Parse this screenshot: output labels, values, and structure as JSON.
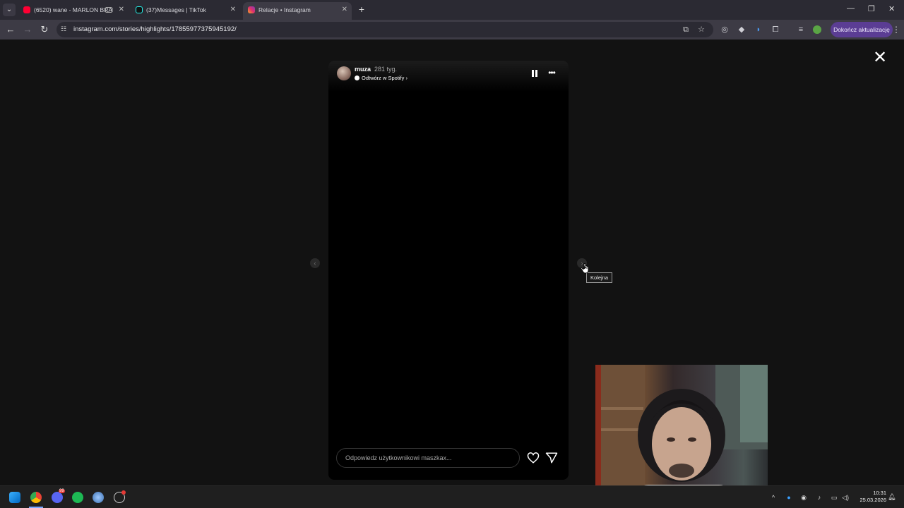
{
  "browser": {
    "tabs": [
      {
        "title": "(6520) wane - MARLON BRANDO",
        "favicon": "youtube-icon",
        "color": "#ff0033",
        "active": false
      },
      {
        "title": "(37)Messages | TikTok",
        "favicon": "tiktok-icon",
        "color": "#25f4ee",
        "active": false
      },
      {
        "title": "Relacje • Instagram",
        "favicon": "instagram-icon",
        "color": "#e1306c",
        "active": true
      }
    ],
    "new_tab": "+",
    "url": "instagram.com/stories/highlights/17855977375945192/",
    "update_button": "Dokończ aktualizację"
  },
  "story": {
    "username": "muza",
    "time_ago": "281 tyg.",
    "music_link": "Odtwórz w Spotify",
    "reply_placeholder": "Odpowiedz użytkownikowi maszkax...",
    "tooltip_next": "Kolejna"
  },
  "taskbar": {
    "time": "10:31",
    "date": "25.03.2026",
    "discord_badge": "99"
  },
  "colors": {
    "tabbar": "#2b2a33",
    "toolbar": "#3d3b45",
    "accent_button": "#5b3d94",
    "page_bg": "#121212",
    "story_bg": "#000000"
  }
}
